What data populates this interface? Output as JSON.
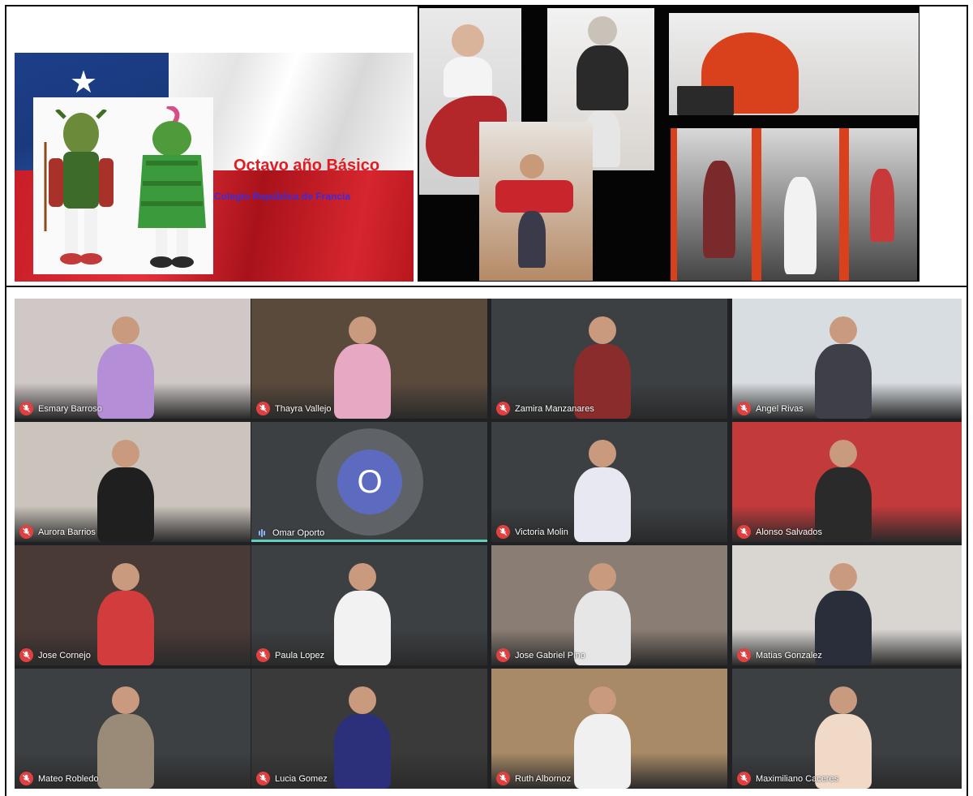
{
  "banner": {
    "title": "Octavo año Básico",
    "subtitle": "Colegio República de Francia",
    "colors": {
      "flag_blue": "#1c3f8a",
      "flag_red": "#d6262f",
      "title": "#e11b22",
      "subtitle": "#3b2be0"
    }
  },
  "meeting": {
    "participants": [
      {
        "name": "Esmary Barroso",
        "mic": "muted",
        "scene": "#cfc8c6",
        "outfit": "#b48fd8"
      },
      {
        "name": "Thayra Vallejo",
        "mic": "muted",
        "scene": "#5a4a3c",
        "outfit": "#e7a8c4"
      },
      {
        "name": "Zamira Manzanares",
        "mic": "muted",
        "scene": "#3c4043",
        "outfit": "#8a2c2c"
      },
      {
        "name": "Angel Rivas",
        "mic": "muted",
        "scene": "#d8dde2",
        "outfit": "#3f3f4a"
      },
      {
        "name": "Aurora Barrios",
        "mic": "muted",
        "scene": "#cbc4bc",
        "outfit": "#1f1f1f"
      },
      {
        "name": "Omar Oporto",
        "mic": "speaking",
        "avatar": "O",
        "scene": "#3c4043",
        "outfit": ""
      },
      {
        "name": "Victoria Molin",
        "mic": "muted",
        "scene": "#3c4043",
        "outfit": "#e8e8f2"
      },
      {
        "name": "Alonso Salvados",
        "mic": "muted",
        "scene": "#c23a3a",
        "outfit": "#2a2a2a"
      },
      {
        "name": "Jose Cornejo",
        "mic": "muted",
        "scene": "#4a3a36",
        "outfit": "#d33c3c"
      },
      {
        "name": "Paula Lopez",
        "mic": "muted",
        "scene": "#3c4043",
        "outfit": "#f2f2f2"
      },
      {
        "name": "Jose Gabriel Pino",
        "mic": "muted",
        "scene": "#8a7e74",
        "outfit": "#e6e6e6"
      },
      {
        "name": "Matias Gonzalez",
        "mic": "muted",
        "scene": "#d9d6d2",
        "outfit": "#2a2d3a"
      },
      {
        "name": "Mateo Robledo",
        "mic": "muted",
        "scene": "#3c4043",
        "outfit": "#9a8a78"
      },
      {
        "name": "Lucia Gomez",
        "mic": "muted",
        "scene": "#3a3a3a",
        "outfit": "#2c2f7a"
      },
      {
        "name": "Ruth Albornoz",
        "mic": "muted",
        "scene": "#a88a66",
        "outfit": "#f0f0f0"
      },
      {
        "name": "Maximiliano Caceres",
        "mic": "muted",
        "scene": "#3c4043",
        "outfit": "#f1d9c8"
      }
    ]
  }
}
